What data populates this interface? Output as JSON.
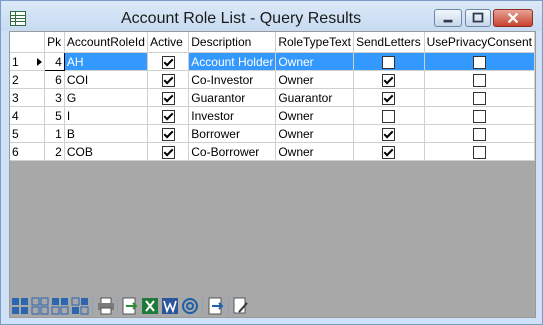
{
  "window": {
    "title": "Account Role List - Query Results"
  },
  "grid": {
    "columns": [
      "Pk",
      "AccountRoleId",
      "Active",
      "Description",
      "RoleTypeText",
      "SendLetters",
      "UsePrivacyConsent"
    ],
    "rows": [
      {
        "idx": "1",
        "pk": "4",
        "id": "AH",
        "active": true,
        "description": "Account Holder",
        "roletype": "Owner",
        "send": false,
        "privacy": false
      },
      {
        "idx": "2",
        "pk": "6",
        "id": "COI",
        "active": true,
        "description": "Co-Investor",
        "roletype": "Owner",
        "send": true,
        "privacy": false
      },
      {
        "idx": "3",
        "pk": "3",
        "id": "G",
        "active": true,
        "description": "Guarantor",
        "roletype": "Guarantor",
        "send": true,
        "privacy": false
      },
      {
        "idx": "4",
        "pk": "5",
        "id": "I",
        "active": true,
        "description": "Investor",
        "roletype": "Owner",
        "send": false,
        "privacy": false
      },
      {
        "idx": "5",
        "pk": "1",
        "id": "B",
        "active": true,
        "description": "Borrower",
        "roletype": "Owner",
        "send": true,
        "privacy": false
      },
      {
        "idx": "6",
        "pk": "2",
        "id": "COB",
        "active": true,
        "description": "Co-Borrower",
        "roletype": "Owner",
        "send": true,
        "privacy": false
      }
    ]
  },
  "toolbar": {
    "icons": [
      "layout-1-icon",
      "layout-2-icon",
      "layout-3-icon",
      "layout-4-icon",
      "print-icon",
      "export-icon",
      "excel-icon",
      "word-icon",
      "email-icon",
      "export-2-icon",
      "edit-document-icon"
    ]
  },
  "colors": {
    "selection": "#3399ff",
    "frame": "#cfe2f7",
    "empty_area": "#a8a8a8"
  }
}
